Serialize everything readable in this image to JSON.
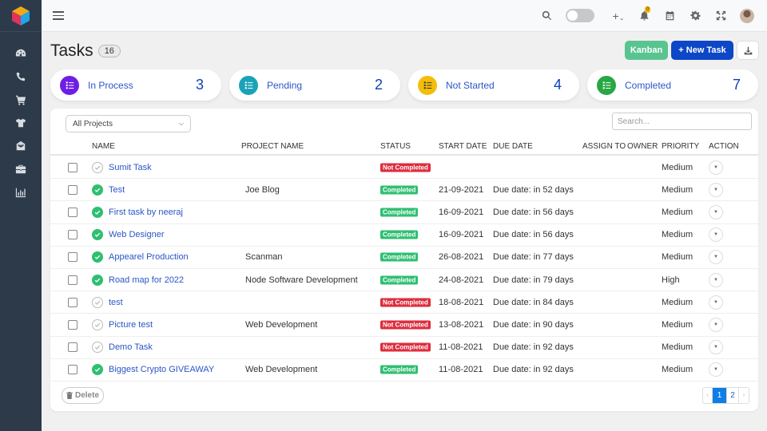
{
  "sidebar": {
    "items": [
      {
        "name": "dashboard",
        "icon": "tachometer-icon"
      },
      {
        "name": "calls",
        "icon": "phone-icon"
      },
      {
        "name": "orders",
        "icon": "cart-icon"
      },
      {
        "name": "products",
        "icon": "tshirt-icon"
      },
      {
        "name": "inbox",
        "icon": "envelope-open-icon"
      },
      {
        "name": "projects",
        "icon": "briefcase-icon"
      },
      {
        "name": "reports",
        "icon": "bar-chart-icon"
      }
    ]
  },
  "topbar": {
    "notification_count": "0",
    "plus_label": "+",
    "plus_chevron": "⌄"
  },
  "page": {
    "title": "Tasks",
    "count": "16"
  },
  "actions": {
    "kanban": "Kanban",
    "new_task": "+ New Task"
  },
  "stats": [
    {
      "label": "In Process",
      "count": "3",
      "color": "#6f1ee6"
    },
    {
      "label": "Pending",
      "count": "2",
      "color": "#1aa3b8"
    },
    {
      "label": "Not Started",
      "count": "4",
      "color": "#f4bd0a"
    },
    {
      "label": "Completed",
      "count": "7",
      "color": "#27a844"
    }
  ],
  "filter": {
    "project_selected": "All Projects",
    "search_placeholder": "Search..."
  },
  "table": {
    "headers": {
      "name": "NAME",
      "project": "PROJECT NAME",
      "status": "STATUS",
      "start": "START DATE",
      "due": "DUE DATE",
      "assign": "ASSIGN TO",
      "owner": "OWNER",
      "priority": "PRIORITY",
      "action": "ACTION"
    },
    "rows": [
      {
        "name": "Sumit Task",
        "project": "",
        "status": "Not Completed",
        "done": false,
        "start": "",
        "due": "",
        "assigned": false,
        "priority": "Medium"
      },
      {
        "name": "Test",
        "project": "Joe Blog",
        "status": "Completed",
        "done": true,
        "start": "21-09-2021",
        "due": "Due date: in 52 days",
        "assigned": true,
        "priority": "Medium"
      },
      {
        "name": "First task by neeraj",
        "project": "",
        "status": "Completed",
        "done": true,
        "start": "16-09-2021",
        "due": "Due date: in 56 days",
        "assigned": false,
        "priority": "Medium"
      },
      {
        "name": "Web Designer",
        "project": "",
        "status": "Completed",
        "done": true,
        "start": "16-09-2021",
        "due": "Due date: in 56 days",
        "assigned": false,
        "priority": "Medium"
      },
      {
        "name": "Appearel Production",
        "project": "Scanman",
        "status": "Completed",
        "done": true,
        "start": "26-08-2021",
        "due": "Due date: in 77 days",
        "assigned": false,
        "priority": "Medium"
      },
      {
        "name": "Road map for 2022",
        "project": "Node Software Development",
        "status": "Completed",
        "done": true,
        "start": "24-08-2021",
        "due": "Due date: in 79 days",
        "assigned": false,
        "priority": "High"
      },
      {
        "name": "test",
        "project": "",
        "status": "Not Completed",
        "done": false,
        "start": "18-08-2021",
        "due": "Due date: in 84 days",
        "assigned": false,
        "priority": "Medium"
      },
      {
        "name": "Picture test",
        "project": "Web Development",
        "status": "Not Completed",
        "done": false,
        "start": "13-08-2021",
        "due": "Due date: in 90 days",
        "assigned": false,
        "priority": "Medium"
      },
      {
        "name": "Demo Task",
        "project": "",
        "status": "Not Completed",
        "done": false,
        "start": "11-08-2021",
        "due": "Due date: in 92 days",
        "assigned": false,
        "priority": "Medium"
      },
      {
        "name": "Biggest Crypto GIVEAWAY",
        "project": "Web Development",
        "status": "Completed",
        "done": true,
        "start": "11-08-2021",
        "due": "Due date: in 92 days",
        "assigned": false,
        "priority": "Medium"
      }
    ]
  },
  "footer": {
    "delete_label": "Delete",
    "pages": [
      "1",
      "2"
    ],
    "current_page": "1",
    "prev": "‹",
    "next": "›"
  }
}
